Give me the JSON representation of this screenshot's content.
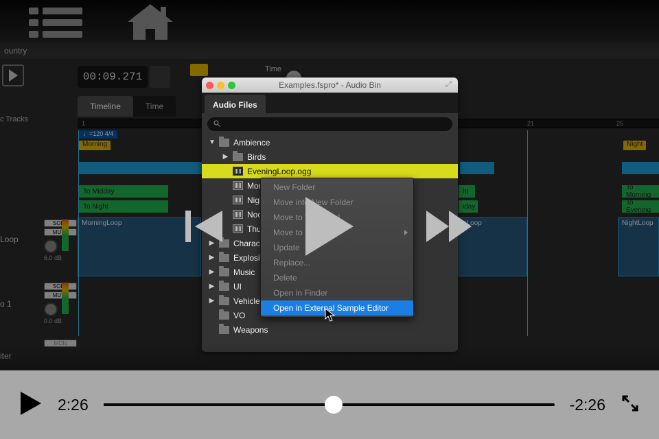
{
  "app": {
    "country_label": "ountry"
  },
  "transport": {
    "timecode": "00:09.271",
    "time_label": "Time",
    "tempo_chip": "♩=120 4/4"
  },
  "tabs": {
    "timeline": "Timeline",
    "time": "Time"
  },
  "tracks_header": "c Tracks",
  "ruler": {
    "m1": "1",
    "m21": "21",
    "m25": "25"
  },
  "markers": {
    "morning": "Morning",
    "night": "Night",
    "to_midday": "To Midday",
    "to_night": "To Night",
    "to_morning": "To Morning",
    "to_evening": "To Evening",
    "to_midday2": "iday"
  },
  "clips": {
    "morningloop": "MorningLoop",
    "gloop": "gLoop",
    "nightloop": "NightLoop"
  },
  "track_controls": {
    "solo": "SOLO",
    "mute": "MUTE",
    "mon": "MON",
    "gain60": "6.0 dB",
    "gain00": "0.0 dB"
  },
  "track_labels": {
    "loop": "Loop",
    "o1": "o 1",
    "iter": "iter"
  },
  "panel": {
    "title": "Examples.fspro* - Audio Bin",
    "tab": "Audio Files",
    "search_placeholder": ""
  },
  "tree": {
    "ambience": "Ambience",
    "birds": "Birds",
    "eveningloop": "EveningLoop.ogg",
    "morn": "Morn",
    "nigh": "Nigh",
    "noon": "Noon",
    "thun": "Thun",
    "charac": "Charac",
    "explosi": "Explosi",
    "music": "Music",
    "ui": "UI",
    "vehicle": "Vehicle",
    "vo": "VO",
    "weapons": "Weapons"
  },
  "context_menu": {
    "new_folder": "New Folder",
    "move_into": "Move into New Folder",
    "move_top": "Move to Top Level",
    "move_to": "Move to",
    "update": "Update",
    "replace": "Replace...",
    "delete": "Delete",
    "open_finder": "Open in Finder",
    "open_ext": "Open in External Sample Editor"
  },
  "player": {
    "elapsed": "2:26",
    "remaining": "-2:26",
    "progress_pct": 51
  }
}
